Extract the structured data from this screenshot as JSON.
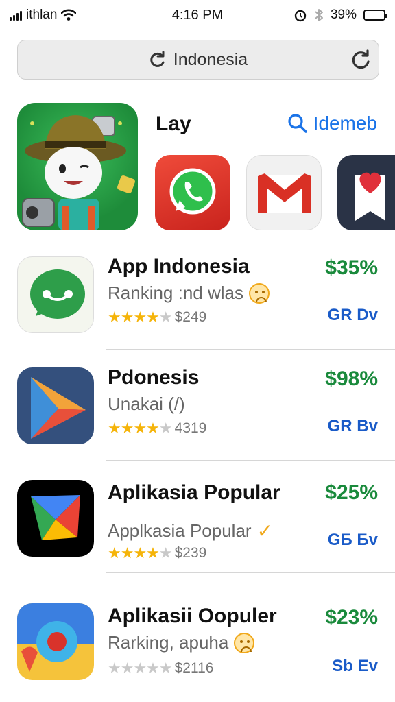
{
  "status": {
    "carrier": "ithlan",
    "time": "4:16 PM",
    "battery": "39%"
  },
  "search": {
    "query": "Indonesia"
  },
  "featured": {
    "title": "Lay",
    "search_label": "Idemeb"
  },
  "apps": [
    {
      "name": "App Indonesia",
      "subtitle": "Ranking :nd wlas",
      "rating_text": "$249",
      "stars": 4,
      "price": "$35%",
      "action": "GR Dv"
    },
    {
      "name": "Pdonesis",
      "subtitle": "Unakai (/)",
      "rating_text": "4319",
      "stars": 4,
      "price": "$98%",
      "action": "GR Bv"
    },
    {
      "name": "Aplikasia Popular",
      "subtitle": "Applkasia Popular",
      "rating_text": "$239",
      "stars": 4,
      "price": "$25%",
      "action": "GБ Бv"
    },
    {
      "name": "Aplikasii Oopuler",
      "subtitle": "Rarking, apuha",
      "rating_text": "$2116",
      "stars": 0,
      "price": "$23%",
      "action": "Sb Ev"
    }
  ],
  "colors": {
    "price": "#1a8a3c",
    "action": "#1a5bc8",
    "link": "#1a73e8",
    "star": "#f5b40a"
  },
  "icons": [
    "wifi-icon",
    "signal-icon",
    "alarm-icon",
    "bluetooth-icon",
    "battery-icon",
    "refresh-icon",
    "search-icon",
    "whatsapp-icon",
    "gmail-icon",
    "play-store-icon",
    "maps-icon",
    "sad-emoji-icon",
    "check-icon",
    "star-icon"
  ]
}
